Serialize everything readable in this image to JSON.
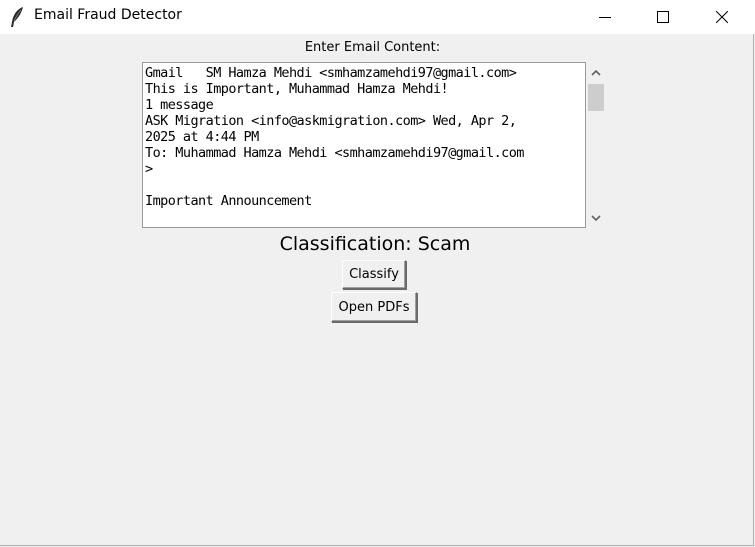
{
  "window": {
    "title": "Email Fraud Detector",
    "icon": "feather-icon",
    "controls": [
      "minimize-icon",
      "maximize-icon",
      "close-icon"
    ]
  },
  "form": {
    "input_label": "Enter Email Content:",
    "email_lines": [
      "Gmail   SM Hamza Mehdi <smhamzamehdi97@gmail.com>",
      "This is Important, Muhammad Hamza Mehdi!",
      "1 message",
      "ASK Migration <info@askmigration.com> Wed, Apr 2,",
      "2025 at 4:44 PM",
      "To: Muhammad Hamza Mehdi <smhamzamehdi97@gmail.com",
      ">",
      "",
      "Important Announcement"
    ],
    "classification": "Classification: Scam",
    "classify_label": "Classify",
    "open_pdfs_label": "Open PDFs"
  },
  "colors": {
    "window_bg": "#f0f0f0",
    "titlebar_bg": "#ffffff",
    "scroll_thumb": "#cdcdcd"
  }
}
